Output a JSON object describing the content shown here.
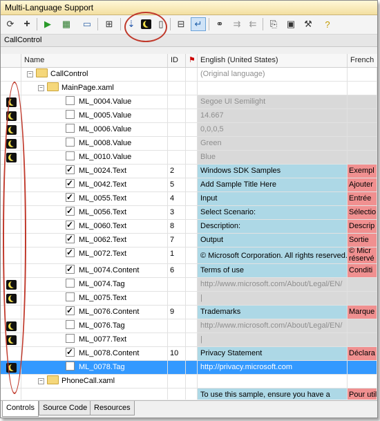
{
  "window": {
    "title": "Multi-Language Support"
  },
  "toolbar": {
    "icons": [
      "refresh-icon",
      "add-icon",
      "play-icon",
      "export-icon",
      "window-icon",
      "tree-icon",
      "sort-icon",
      "moon-icon",
      "layout-icon",
      "grid-icon",
      "enter-icon",
      "binoculars-icon",
      "find-next-icon",
      "find-prev-icon",
      "copy-icon",
      "tools-icon",
      "help-icon"
    ]
  },
  "control_bar": {
    "label": "CallControl"
  },
  "columns": {
    "name": "Name",
    "id": "ID",
    "english": "English (United States)",
    "french": "French"
  },
  "rows": [
    {
      "name": "CallControl",
      "level": 0,
      "kind": "folder",
      "en": "(Original language)",
      "en_style": "gray"
    },
    {
      "name": "MainPage.xaml",
      "level": 1,
      "kind": "folder"
    },
    {
      "name": "ML_0004.Value",
      "moon": true,
      "checked": false,
      "en": "Segoe UI Semilight",
      "en_style": "gray-text",
      "fr_style": "gray-cell"
    },
    {
      "name": "ML_0005.Value",
      "moon": true,
      "checked": false,
      "en": "14.667",
      "en_style": "gray-text",
      "fr_style": "gray-cell"
    },
    {
      "name": "ML_0006.Value",
      "moon": true,
      "checked": false,
      "en": "0,0,0,5",
      "en_style": "gray-text",
      "fr_style": "gray-cell"
    },
    {
      "name": "ML_0008.Value",
      "moon": true,
      "checked": false,
      "en": "Green",
      "en_style": "gray-text",
      "fr_style": "gray-cell"
    },
    {
      "name": "ML_0010.Value",
      "moon": true,
      "checked": false,
      "en": "Blue",
      "en_style": "gray-text",
      "fr_style": "gray-cell"
    },
    {
      "name": "ML_0024.Text",
      "checked": true,
      "id": "2",
      "en": "Windows SDK Samples",
      "fr": "Exempl",
      "en_style": "blue",
      "fr_style": "red"
    },
    {
      "name": "ML_0042.Text",
      "checked": true,
      "id": "5",
      "en": "Add Sample Title Here",
      "fr": "Ajouter",
      "en_style": "blue",
      "fr_style": "red"
    },
    {
      "name": "ML_0055.Text",
      "checked": true,
      "id": "4",
      "en": "Input",
      "fr": "Entrée",
      "en_style": "blue",
      "fr_style": "red"
    },
    {
      "name": "ML_0056.Text",
      "checked": true,
      "id": "3",
      "en": "Select Scenario:",
      "fr": "Sélectio",
      "en_style": "blue",
      "fr_style": "red"
    },
    {
      "name": "ML_0060.Text",
      "checked": true,
      "id": "8",
      "en": "Description:",
      "fr": "Descrip",
      "en_style": "blue",
      "fr_style": "red"
    },
    {
      "name": "ML_0062.Text",
      "checked": true,
      "id": "7",
      "en": "Output",
      "fr": "Sortie",
      "en_style": "blue",
      "fr_style": "red"
    },
    {
      "name": "ML_0072.Text",
      "checked": true,
      "id": "1",
      "en": "© Microsoft Corporation. All rights reserved.",
      "fr": "© Micr",
      "fr2": "réservé",
      "en_style": "blue",
      "fr_style": "red",
      "tall": true
    },
    {
      "name": "ML_0074.Content",
      "checked": true,
      "id": "6",
      "en": "Terms of use",
      "fr": "Conditi",
      "en_style": "blue",
      "fr_style": "red"
    },
    {
      "name": "ML_0074.Tag",
      "moon": true,
      "checked": false,
      "en": "http://www.microsoft.com/About/Legal/EN/",
      "en_style": "gray-text",
      "fr_style": "gray-cell"
    },
    {
      "name": "ML_0075.Text",
      "moon": true,
      "checked": false,
      "en": "|",
      "en_style": "gray-text",
      "fr_style": "gray-cell"
    },
    {
      "name": "ML_0076.Content",
      "checked": true,
      "id": "9",
      "en": "Trademarks",
      "fr": "Marque",
      "en_style": "blue",
      "fr_style": "red"
    },
    {
      "name": "ML_0076.Tag",
      "moon": true,
      "checked": false,
      "en": "http://www.microsoft.com/About/Legal/EN/",
      "en_style": "gray-text",
      "fr_style": "gray-cell"
    },
    {
      "name": "ML_0077.Text",
      "moon": true,
      "checked": false,
      "en": "|",
      "en_style": "gray-text",
      "fr_style": "gray-cell"
    },
    {
      "name": "ML_0078.Content",
      "checked": true,
      "id": "10",
      "en": "Privacy Statement",
      "fr": "Déclara",
      "en_style": "blue",
      "fr_style": "red"
    },
    {
      "name": "ML_0078.Tag",
      "moon": true,
      "checked": false,
      "en": "http://privacy.microsoft.com",
      "selected": true
    },
    {
      "name": "PhoneCall.xaml",
      "level": 1,
      "kind": "folder"
    },
    {
      "name": "",
      "en": "To use this sample, ensure you have a",
      "fr": "Pour util",
      "en_style": "blue",
      "fr_style": "red",
      "partial": true
    }
  ],
  "tabs": [
    "Controls",
    "Source Code",
    "Resources"
  ],
  "colors": {
    "translated_en": "#add8e6",
    "translated_fr": "#f09090",
    "selected": "#3399ff",
    "annotation": "#c0392b"
  }
}
